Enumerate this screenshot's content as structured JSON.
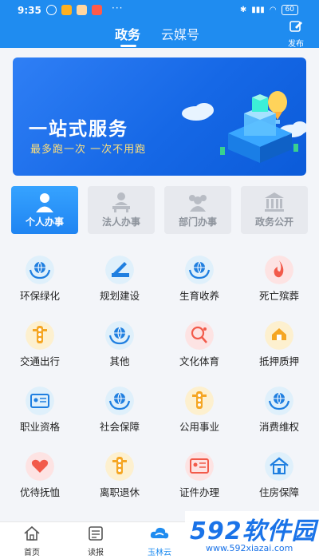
{
  "status": {
    "time": "9:35",
    "dots": "···",
    "battery": "60"
  },
  "tabs": [
    "政务",
    "云媒号"
  ],
  "publish_label": "发布",
  "banner": {
    "title": "一站式服务",
    "subtitle": "最多跑一次 一次不用跑"
  },
  "categories": [
    {
      "label": "个人办事",
      "active": true
    },
    {
      "label": "法人办事",
      "active": false
    },
    {
      "label": "部门办事",
      "active": false
    },
    {
      "label": "政务公开",
      "active": false
    }
  ],
  "services": [
    {
      "label": "环保绿化",
      "icon": "globe-hands-icon",
      "color": "#dff0fb"
    },
    {
      "label": "规划建设",
      "icon": "ruler-pencil-icon",
      "color": "#dff0fb"
    },
    {
      "label": "生育收养",
      "icon": "globe-hands-icon",
      "color": "#dff0fb"
    },
    {
      "label": "死亡殡葬",
      "icon": "flame-icon",
      "color": "#fde3e3"
    },
    {
      "label": "交通出行",
      "icon": "traffic-light-icon",
      "color": "#fdf0cf"
    },
    {
      "label": "其他",
      "icon": "globe-hands-icon",
      "color": "#dff0fb"
    },
    {
      "label": "文化体育",
      "icon": "ping-pong-icon",
      "color": "#fde3e3"
    },
    {
      "label": "抵押质押",
      "icon": "house-hand-icon",
      "color": "#fdf0cf"
    },
    {
      "label": "职业资格",
      "icon": "id-card-icon",
      "color": "#dff0fb"
    },
    {
      "label": "社会保障",
      "icon": "globe-hands-icon",
      "color": "#dff0fb"
    },
    {
      "label": "公用事业",
      "icon": "traffic-light-icon",
      "color": "#fdf0cf"
    },
    {
      "label": "消费维权",
      "icon": "globe-hands-icon",
      "color": "#dff0fb"
    },
    {
      "label": "优待抚恤",
      "icon": "heart-hand-icon",
      "color": "#fde3e3"
    },
    {
      "label": "离职退休",
      "icon": "traffic-light-icon",
      "color": "#fdf0cf"
    },
    {
      "label": "证件办理",
      "icon": "certificate-icon",
      "color": "#fde3e3"
    },
    {
      "label": "住房保障",
      "icon": "house-icon",
      "color": "#dff0fb"
    }
  ],
  "bottom_nav": [
    {
      "label": "首页",
      "icon": "home-icon",
      "active": false
    },
    {
      "label": "读报",
      "icon": "newspaper-icon",
      "active": false
    },
    {
      "label": "玉林云",
      "icon": "cloud-icon",
      "active": true
    }
  ],
  "watermark": {
    "text": "592软件园",
    "url": "www.592xiazai.com"
  },
  "colors": {
    "primary": "#1f8cf0",
    "banner_subtitle": "#ffe07a"
  }
}
